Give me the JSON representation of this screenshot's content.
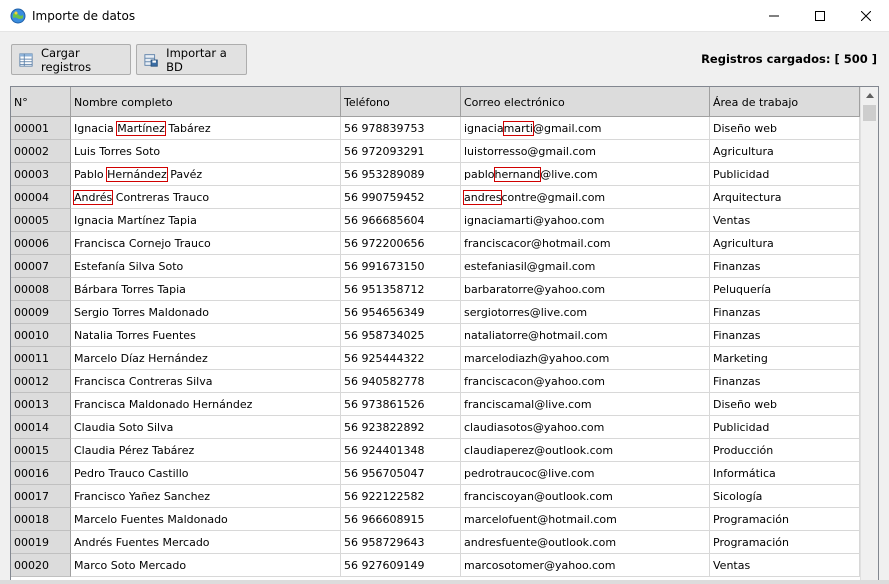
{
  "window": {
    "title": "Importe de datos"
  },
  "toolbar": {
    "load_label": "Cargar registros",
    "import_label": "Importar a BD",
    "records_label": "Registros cargados: [ 500 ]"
  },
  "grid": {
    "columns": [
      "N°",
      "Nombre completo",
      "Teléfono",
      "Correo electrónico",
      "Área de trabajo"
    ],
    "rows": [
      {
        "id": "00001",
        "name": {
          "pre": "Ignacia ",
          "hl": "Martínez",
          "post": " Tabárez"
        },
        "phone": "56 978839753",
        "email": {
          "pre": "ignacia",
          "hl": "marti",
          "post": "@gmail.com"
        },
        "area": "Diseño web"
      },
      {
        "id": "00002",
        "name": {
          "pre": "Luis Torres Soto",
          "hl": "",
          "post": ""
        },
        "phone": "56 972093291",
        "email": {
          "pre": "luistorresso@gmail.com",
          "hl": "",
          "post": ""
        },
        "area": "Agricultura"
      },
      {
        "id": "00003",
        "name": {
          "pre": "Pablo ",
          "hl": "Hernández",
          "post": " Pavéz"
        },
        "phone": "56 953289089",
        "email": {
          "pre": "pablo",
          "hl": "hernand",
          "post": "@live.com"
        },
        "area": "Publicidad"
      },
      {
        "id": "00004",
        "name": {
          "pre": "",
          "hl": "Andrés",
          "post": " Contreras Trauco"
        },
        "phone": "56 990759452",
        "email": {
          "pre": "",
          "hl": "andres",
          "post": "contre@gmail.com"
        },
        "area": "Arquitectura"
      },
      {
        "id": "00005",
        "name": {
          "pre": "Ignacia Martínez Tapia",
          "hl": "",
          "post": ""
        },
        "phone": "56 966685604",
        "email": {
          "pre": "ignaciamarti@yahoo.com",
          "hl": "",
          "post": ""
        },
        "area": "Ventas"
      },
      {
        "id": "00006",
        "name": {
          "pre": "Francisca Cornejo Trauco",
          "hl": "",
          "post": ""
        },
        "phone": "56 972200656",
        "email": {
          "pre": "franciscacor@hotmail.com",
          "hl": "",
          "post": ""
        },
        "area": "Agricultura"
      },
      {
        "id": "00007",
        "name": {
          "pre": "Estefanía Silva Soto",
          "hl": "",
          "post": ""
        },
        "phone": "56 991673150",
        "email": {
          "pre": "estefaniasil@gmail.com",
          "hl": "",
          "post": ""
        },
        "area": "Finanzas"
      },
      {
        "id": "00008",
        "name": {
          "pre": "Bárbara Torres Tapia",
          "hl": "",
          "post": ""
        },
        "phone": "56 951358712",
        "email": {
          "pre": "barbaratorre@yahoo.com",
          "hl": "",
          "post": ""
        },
        "area": "Peluquería"
      },
      {
        "id": "00009",
        "name": {
          "pre": "Sergio Torres Maldonado",
          "hl": "",
          "post": ""
        },
        "phone": "56 954656349",
        "email": {
          "pre": "sergiotorres@live.com",
          "hl": "",
          "post": ""
        },
        "area": "Finanzas"
      },
      {
        "id": "00010",
        "name": {
          "pre": "Natalia Torres Fuentes",
          "hl": "",
          "post": ""
        },
        "phone": "56 958734025",
        "email": {
          "pre": "nataliatorre@hotmail.com",
          "hl": "",
          "post": ""
        },
        "area": "Finanzas"
      },
      {
        "id": "00011",
        "name": {
          "pre": "Marcelo Díaz Hernández",
          "hl": "",
          "post": ""
        },
        "phone": "56 925444322",
        "email": {
          "pre": "marcelodiazh@yahoo.com",
          "hl": "",
          "post": ""
        },
        "area": "Marketing"
      },
      {
        "id": "00012",
        "name": {
          "pre": "Francisca Contreras Silva",
          "hl": "",
          "post": ""
        },
        "phone": "56 940582778",
        "email": {
          "pre": "franciscacon@yahoo.com",
          "hl": "",
          "post": ""
        },
        "area": "Finanzas"
      },
      {
        "id": "00013",
        "name": {
          "pre": "Francisca Maldonado Hernández",
          "hl": "",
          "post": ""
        },
        "phone": "56 973861526",
        "email": {
          "pre": "franciscamal@live.com",
          "hl": "",
          "post": ""
        },
        "area": "Diseño web"
      },
      {
        "id": "00014",
        "name": {
          "pre": "Claudia Soto Silva",
          "hl": "",
          "post": ""
        },
        "phone": "56 923822892",
        "email": {
          "pre": "claudiasotos@yahoo.com",
          "hl": "",
          "post": ""
        },
        "area": "Publicidad"
      },
      {
        "id": "00015",
        "name": {
          "pre": "Claudia Pérez Tabárez",
          "hl": "",
          "post": ""
        },
        "phone": "56 924401348",
        "email": {
          "pre": "claudiaperez@outlook.com",
          "hl": "",
          "post": ""
        },
        "area": "Producción"
      },
      {
        "id": "00016",
        "name": {
          "pre": "Pedro Trauco Castillo",
          "hl": "",
          "post": ""
        },
        "phone": "56 956705047",
        "email": {
          "pre": "pedrotraucoc@live.com",
          "hl": "",
          "post": ""
        },
        "area": "Informática"
      },
      {
        "id": "00017",
        "name": {
          "pre": "Francisco Yañez Sanchez",
          "hl": "",
          "post": ""
        },
        "phone": "56 922122582",
        "email": {
          "pre": "franciscoyan@outlook.com",
          "hl": "",
          "post": ""
        },
        "area": "Sicología"
      },
      {
        "id": "00018",
        "name": {
          "pre": "Marcelo Fuentes Maldonado",
          "hl": "",
          "post": ""
        },
        "phone": "56 966608915",
        "email": {
          "pre": "marcelofuent@hotmail.com",
          "hl": "",
          "post": ""
        },
        "area": "Programación"
      },
      {
        "id": "00019",
        "name": {
          "pre": "Andrés Fuentes Mercado",
          "hl": "",
          "post": ""
        },
        "phone": "56 958729643",
        "email": {
          "pre": "andresfuente@outlook.com",
          "hl": "",
          "post": ""
        },
        "area": "Programación"
      },
      {
        "id": "00020",
        "name": {
          "pre": "Marco Soto Mercado",
          "hl": "",
          "post": ""
        },
        "phone": "56 927609149",
        "email": {
          "pre": "marcosotomer@yahoo.com",
          "hl": "",
          "post": ""
        },
        "area": "Ventas"
      }
    ]
  },
  "icons": {
    "app": "globe-icon",
    "load": "table-icon",
    "import": "database-save-icon",
    "minimize": "minimize-icon",
    "maximize": "maximize-icon",
    "close": "close-icon"
  },
  "colors": {
    "highlight": "#d00000",
    "header_bg": "#dcdcdc"
  }
}
